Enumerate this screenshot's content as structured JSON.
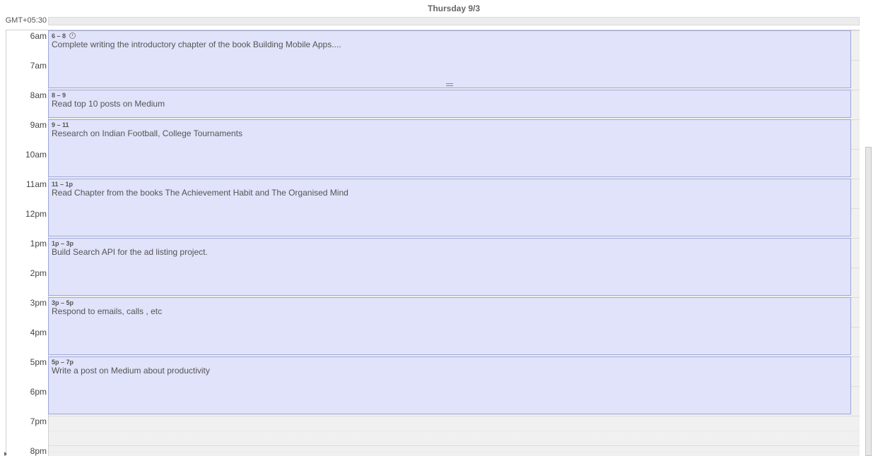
{
  "header": {
    "day_label": "Thursday 9/3",
    "timezone": "GMT+05:30"
  },
  "hours": [
    "6am",
    "7am",
    "8am",
    "9am",
    "10am",
    "11am",
    "12pm",
    "1pm",
    "2pm",
    "3pm",
    "4pm",
    "5pm",
    "6pm",
    "7pm",
    "8pm"
  ],
  "events": [
    {
      "time": "6 – 8",
      "title": "Complete writing the introductory chapter of the book Building Mobile Apps....",
      "has_alarm": true,
      "alarm_icon": "alarm-clock-icon",
      "selected": true
    },
    {
      "time": "8 – 9",
      "title": "Read top 10 posts on Medium"
    },
    {
      "time": "9 – 11",
      "title": "Research on Indian Football, College Tournaments"
    },
    {
      "time": "11 – 1p",
      "title": "Read Chapter from the books The Achievement Habit and The Organised Mind"
    },
    {
      "time": "1p – 3p",
      "title": "Build Search API for the ad listing project."
    },
    {
      "time": "3p – 5p",
      "title": "Respond to emails, calls , etc"
    },
    {
      "time": "5p – 7p",
      "title": "Write a post on Medium about productivity"
    }
  ],
  "colors": {
    "event_fill": "#e0e3fa",
    "event_border": "#9fa6d9",
    "grid_bg": "#f0f0f0"
  }
}
